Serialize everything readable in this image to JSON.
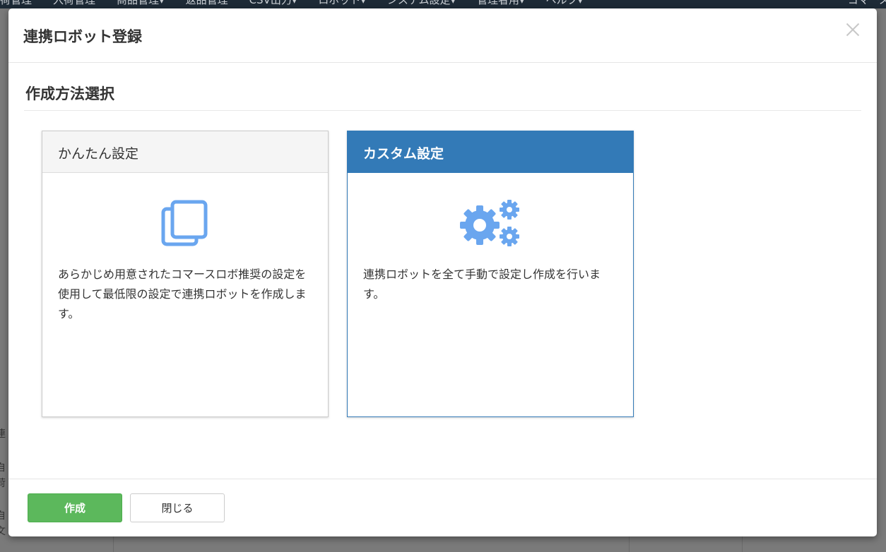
{
  "background_nav": {
    "items": [
      "荷管理",
      "入荷管理",
      "商品管理▾",
      "返品管理",
      "CSV出力▾",
      "ロボット▾",
      "システム設定▾",
      "管理者用▾",
      "ヘルプ▾"
    ],
    "right_label": "コマースロ"
  },
  "background_strip": [
    "連",
    "自",
    "荷",
    "自",
    "文"
  ],
  "modal": {
    "title": "連携ロボット登録",
    "section_title": "作成方法選択",
    "cards": [
      {
        "title": "かんたん設定",
        "icon": "copy-icon",
        "description": "あらかじめ用意されたコマースロボ推奨の設定を使用して最低限の設定で連携ロボットを作成します。",
        "selected": false
      },
      {
        "title": "カスタム設定",
        "icon": "gears-icon",
        "description": "連携ロボットを全て手動で設定し作成を行います。",
        "selected": true
      }
    ],
    "buttons": {
      "create": "作成",
      "close": "閉じる"
    }
  },
  "colors": {
    "primary": "#337ab7",
    "success": "#5cb85c",
    "icon": "#6aa6ef"
  }
}
